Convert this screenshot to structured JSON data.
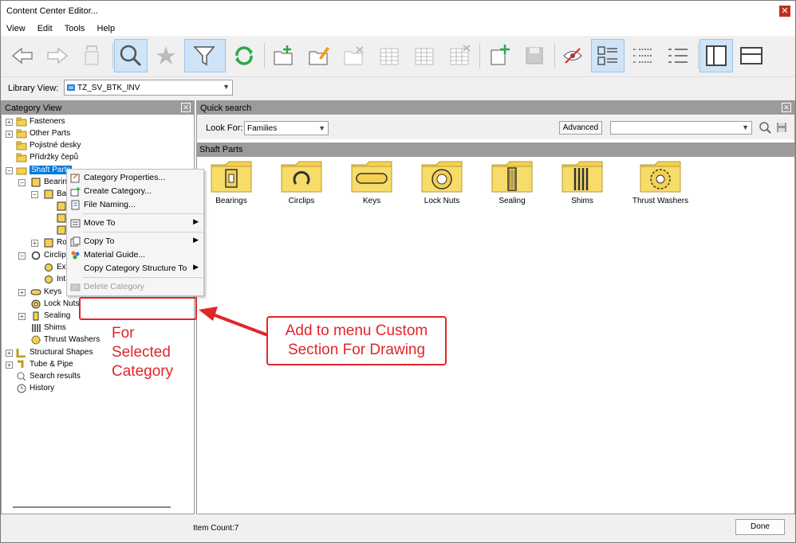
{
  "window": {
    "title": "Content Center Editor...",
    "close_glyph": "✕"
  },
  "menu": [
    "View",
    "Edit",
    "Tools",
    "Help"
  ],
  "toolbar": {
    "buttons": [
      "back-arrow-icon",
      "forward-arrow-icon",
      "replace-icon",
      "search-icon",
      "favorite-star-icon",
      "filter-icon",
      "refresh-icon",
      "new-family-icon",
      "edit-family-icon",
      "delete-family-icon",
      "table-icon",
      "table-edit-icon",
      "table-delete-icon",
      "new-item-icon",
      "save-icon",
      "publish-icon",
      "large-icons-view-icon",
      "list-view-icon",
      "details-view-icon",
      "tree-view-icon",
      "split-view-icon"
    ]
  },
  "library": {
    "label": "Library View:",
    "value": "TZ_SV_BTK_INV"
  },
  "left_panel": {
    "title": "Category View",
    "tree": [
      "Fasteners",
      "Other Parts",
      "Pojistné desky",
      "Přídržky čepů",
      "Shaft Parts",
      "Bearing",
      "Bal",
      "",
      "",
      "",
      "Rol",
      "Circlips",
      "Ext",
      "Int",
      "Keys",
      "Lock Nuts",
      "Sealing",
      "Shims",
      "Thrust Washers",
      "Structural Shapes",
      "Tube & Pipe",
      "Search results",
      "History"
    ]
  },
  "context_menu": {
    "items": [
      "Category Properties...",
      "Create Category...",
      "File Naming...",
      "Move To",
      "Copy To",
      "Material Guide...",
      "Copy Category Structure To",
      "Delete Category"
    ]
  },
  "right_panel": {
    "title": "Quick search",
    "look_for_label": "Look For:",
    "look_for_value": "Families",
    "advanced_label": "Advanced",
    "section_title": "Shaft Parts",
    "families": [
      "Bearings",
      "Circlips",
      "Keys",
      "Lock Nuts",
      "Sealing",
      "Shims",
      "Thrust Washers"
    ]
  },
  "status": {
    "item_count": "Item Count:7",
    "done_label": "Done"
  },
  "annotations": {
    "note": [
      "For",
      "Selected",
      "Category"
    ],
    "callout": [
      "Add to menu Custom",
      "Section For Drawing"
    ]
  },
  "colors": {
    "accent": "#0078d7",
    "annotation": "#e0262a",
    "folder": "#f5d050",
    "header": "#9b9b9b"
  }
}
